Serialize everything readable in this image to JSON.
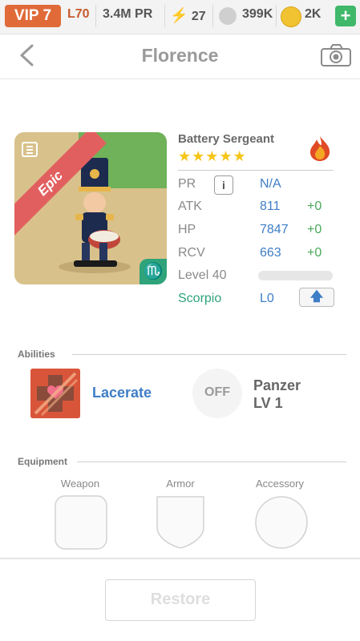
{
  "status_bar": {
    "vip": "VIP 7",
    "level": "L70",
    "pr": "3.4M PR",
    "energy": "27",
    "paws": "399K",
    "coins": "2K",
    "plus": "+"
  },
  "header": {
    "title": "Florence"
  },
  "hero": {
    "rarity": "Epic",
    "name": "Battery Sergeant",
    "stars": "★★★★★",
    "star_count": 5,
    "stats": [
      {
        "label": "PR",
        "value": "N/A",
        "bonus": ""
      },
      {
        "label": "ATK",
        "value": "811",
        "bonus": "+0"
      },
      {
        "label": "HP",
        "value": "7847",
        "bonus": "+0"
      },
      {
        "label": "RCV",
        "value": "663",
        "bonus": "+0"
      }
    ],
    "level_label": "Level 40",
    "level_progress": 0,
    "zodiac_label": "Scorpio",
    "zodiac_level": "L0",
    "zodiac_symbol": "♏"
  },
  "abilities": {
    "heading": "Abilities",
    "items": [
      {
        "name": "Lacerate"
      },
      {
        "name_line1": "Panzer",
        "name_line2": "LV 1",
        "status": "OFF"
      }
    ]
  },
  "equipment": {
    "heading": "Equipment",
    "slots": [
      "Weapon",
      "Armor",
      "Accessory"
    ]
  },
  "footer": {
    "restore_label": "Restore"
  },
  "colors": {
    "accent_blue": "#3f7ec6",
    "bonus_green": "#4aa85b",
    "vip_orange": "#e06a38",
    "epic_red": "#e25f60",
    "scorpio_green": "#2fa37a"
  }
}
